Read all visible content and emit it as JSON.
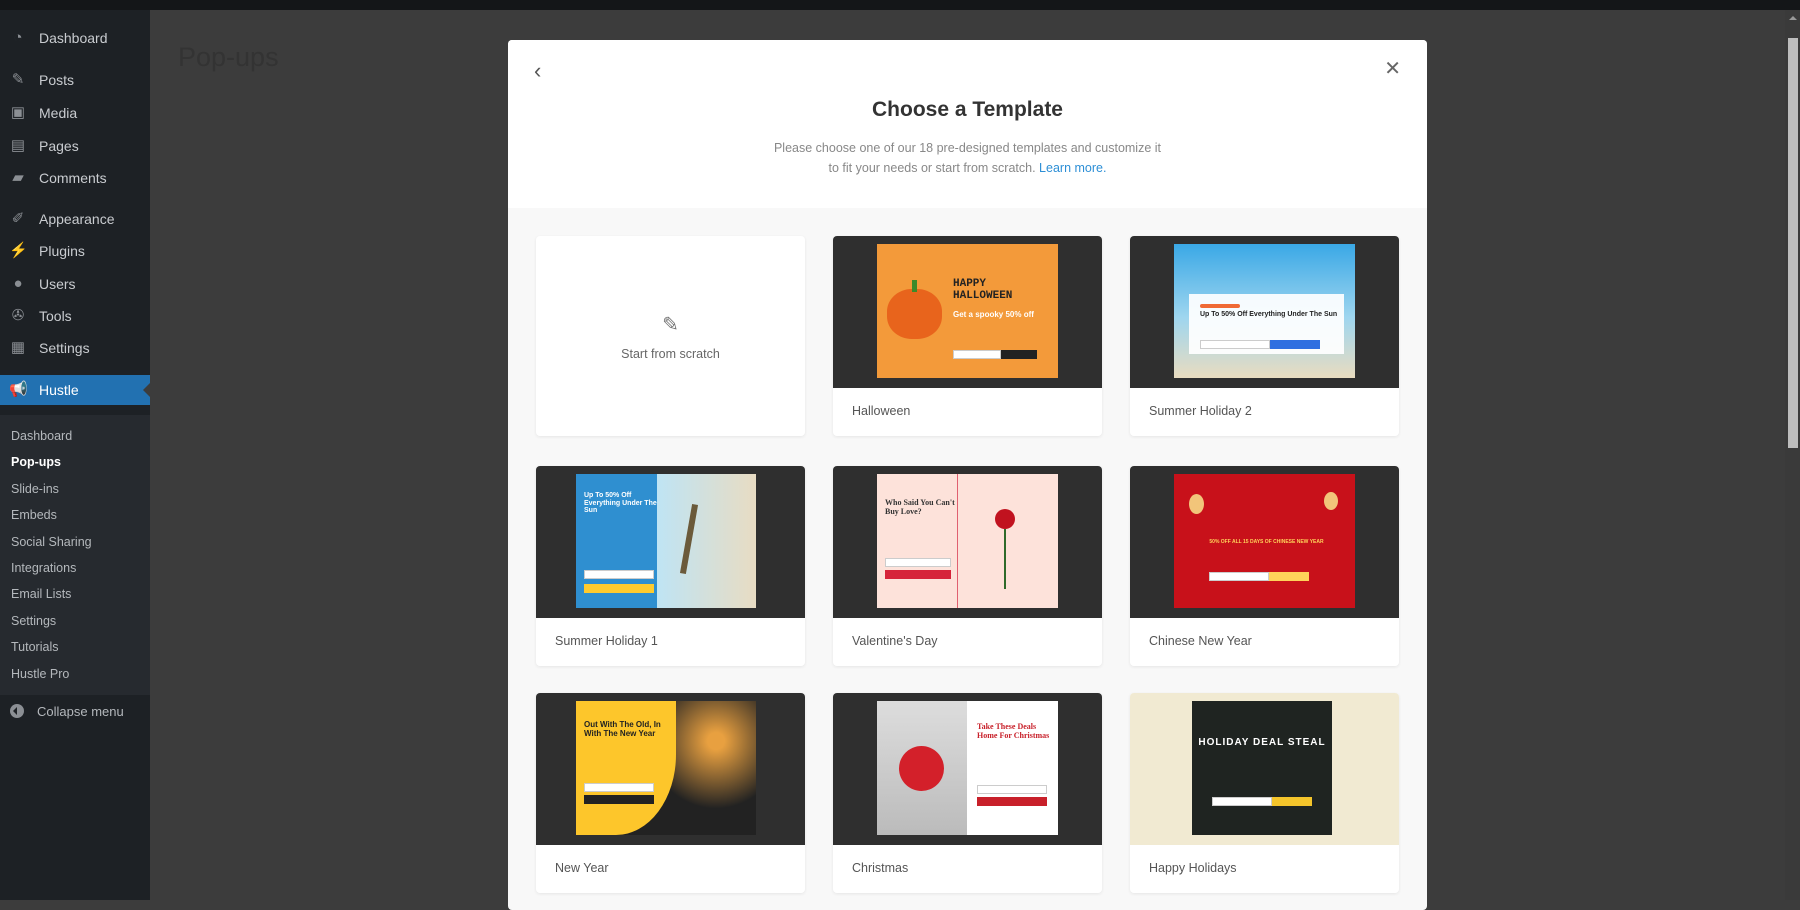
{
  "sidebar": {
    "items": [
      {
        "label": "Dashboard",
        "icon": "dashboard-icon",
        "glyph": "◔"
      },
      {
        "label": "Posts",
        "icon": "pin-icon",
        "glyph": "✎"
      },
      {
        "label": "Media",
        "icon": "media-icon",
        "glyph": "▣"
      },
      {
        "label": "Pages",
        "icon": "pages-icon",
        "glyph": "▤"
      },
      {
        "label": "Comments",
        "icon": "comment-icon",
        "glyph": "▰"
      },
      {
        "label": "Appearance",
        "icon": "brush-icon",
        "glyph": "✐"
      },
      {
        "label": "Plugins",
        "icon": "plugin-icon",
        "glyph": "⚡"
      },
      {
        "label": "Users",
        "icon": "user-icon",
        "glyph": "●"
      },
      {
        "label": "Tools",
        "icon": "wrench-icon",
        "glyph": "✇"
      },
      {
        "label": "Settings",
        "icon": "settings-icon",
        "glyph": "▦"
      },
      {
        "label": "Hustle",
        "icon": "megaphone-icon",
        "glyph": "📢"
      }
    ],
    "submenu": [
      "Dashboard",
      "Pop-ups",
      "Slide-ins",
      "Embeds",
      "Social Sharing",
      "Integrations",
      "Email Lists",
      "Settings",
      "Tutorials",
      "Hustle Pro"
    ],
    "current_submenu": "Pop-ups",
    "collapse": "Collapse menu",
    "accent": "#2271b1"
  },
  "page": {
    "title": "Pop-ups"
  },
  "modal": {
    "title": "Choose a Template",
    "subtitle_1": "Please choose one of our 18 pre-designed templates and customize it",
    "subtitle_2": "to fit your needs or start from scratch.",
    "learn_more": "Learn more.",
    "link_color": "#2d8fd6",
    "scratch": "Start from scratch",
    "templates": [
      {
        "name": "Halloween",
        "heading": "HAPPY HALLOWEEN",
        "sub": "Get a spooky 50% off",
        "color": "#f39a3a"
      },
      {
        "name": "Summer Holiday 2",
        "heading": "Up To 50% Off Everything Under The Sun",
        "color": "#ffffff"
      },
      {
        "name": "Summer Holiday 1",
        "heading": "Up To 50% Off Everything Under The Sun",
        "color": "#2f8fd0"
      },
      {
        "name": "Valentine's Day",
        "heading": "Who Said You Can't Buy Love?",
        "color": "#fde2da"
      },
      {
        "name": "Chinese New Year",
        "heading": "50% OFF ALL 15 DAYS OF CHINESE NEW YEAR",
        "color": "#c8111a"
      },
      {
        "name": "New Year",
        "heading": "Out With The Old, In With The New Year",
        "color": "#fdc62b"
      },
      {
        "name": "Christmas",
        "heading": "Take These Deals Home For Christmas",
        "color": "#ffffff"
      },
      {
        "name": "Happy Holidays",
        "heading": "HOLIDAY DEAL STEAL",
        "color": "#1f2421"
      }
    ]
  }
}
